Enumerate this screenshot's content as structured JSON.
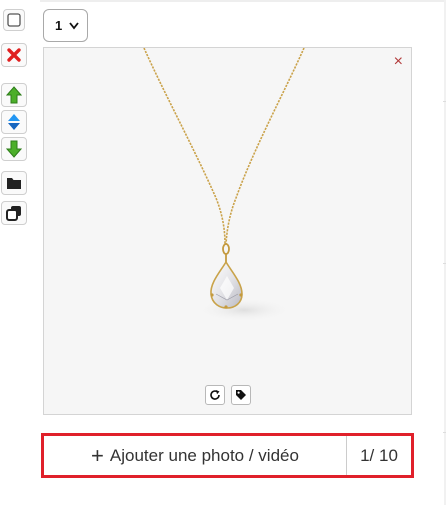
{
  "controls": {
    "count_select_value": "1"
  },
  "toolbar": {
    "items": [
      {
        "icon": "checkbox-icon"
      },
      {
        "icon": "delete-icon",
        "color": "#e02020"
      },
      {
        "icon": "move-up-icon",
        "color": "#3c9a22"
      },
      {
        "icon": "move-updown-icon",
        "color": "#1e88e5"
      },
      {
        "icon": "move-down-icon",
        "color": "#3c9a22"
      },
      {
        "icon": "folder-icon"
      },
      {
        "icon": "duplicate-icon"
      }
    ]
  },
  "photo": {
    "subject": "gold-pendant-necklace-image",
    "remove_label": "×",
    "actions": [
      {
        "icon": "rotate-icon"
      },
      {
        "icon": "tag-icon"
      }
    ]
  },
  "add_media": {
    "plus": "+",
    "label": "Ajouter une photo / vidéo",
    "count": "1/ 10",
    "highlight_color": "#e0202a"
  }
}
